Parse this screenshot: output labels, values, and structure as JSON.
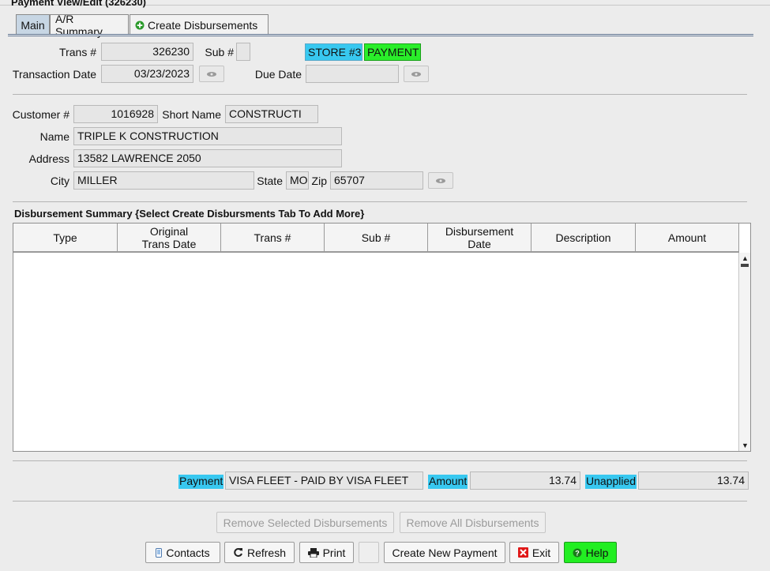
{
  "window": {
    "title": "Payment View/Edit  (326230)"
  },
  "tabs": [
    {
      "label": "Main"
    },
    {
      "label": "A/R Summary"
    },
    {
      "label": "Create Disbursements"
    }
  ],
  "header": {
    "trans_label": "Trans #",
    "trans_value": "326230",
    "sub_label": "Sub #",
    "sub_value": "",
    "store_tag": "STORE #3",
    "type_tag": "PAYMENT",
    "trans_date_label": "Transaction Date",
    "trans_date_value": "03/23/2023",
    "due_date_label": "Due Date",
    "due_date_value": ""
  },
  "customer": {
    "customer_label": "Customer #",
    "customer_value": "1016928",
    "short_name_label": "Short Name",
    "short_name_value": "CONSTRUCTI",
    "name_label": "Name",
    "name_value": "TRIPLE K CONSTRUCTION",
    "address_label": "Address",
    "address_value": "13582 LAWRENCE 2050",
    "city_label": "City",
    "city_value": "MILLER",
    "state_label": "State",
    "state_value": "MO",
    "zip_label": "Zip",
    "zip_value": "65707"
  },
  "disbursements": {
    "title": "Disbursement Summary {Select Create Disbursments Tab To Add More}",
    "columns": [
      "Type",
      "Original\nTrans Date",
      "Trans #",
      "Sub #",
      "Disbursement\nDate",
      "Description",
      "Amount"
    ],
    "rows": []
  },
  "summary": {
    "payment_label": "Payment",
    "payment_value": "VISA FLEET - PAID BY VISA FLEET",
    "amount_label": "Amount",
    "amount_value": "13.74",
    "unapplied_label": "Unapplied",
    "unapplied_value": "13.74"
  },
  "actions": {
    "remove_selected": "Remove Selected Disbursements",
    "remove_all": "Remove All Disbursements",
    "contacts": "Contacts",
    "refresh": "Refresh",
    "print": "Print",
    "create_new": "Create New Payment",
    "exit": "Exit",
    "help": "Help"
  },
  "colors": {
    "store_tag": "#38c8f0",
    "payment_tag": "#2aee2a",
    "highlight": "#38c8f0",
    "help_button": "#22ee22",
    "exit_icon": "#e01818",
    "tab_active": "#c7d6e4"
  },
  "icons": {
    "lookup": "eye-icon",
    "add_tab": "plus-circle-icon",
    "contacts": "phone-icon",
    "refresh": "refresh-icon",
    "print": "printer-icon",
    "exit": "close-x-icon",
    "help": "question-icon"
  }
}
